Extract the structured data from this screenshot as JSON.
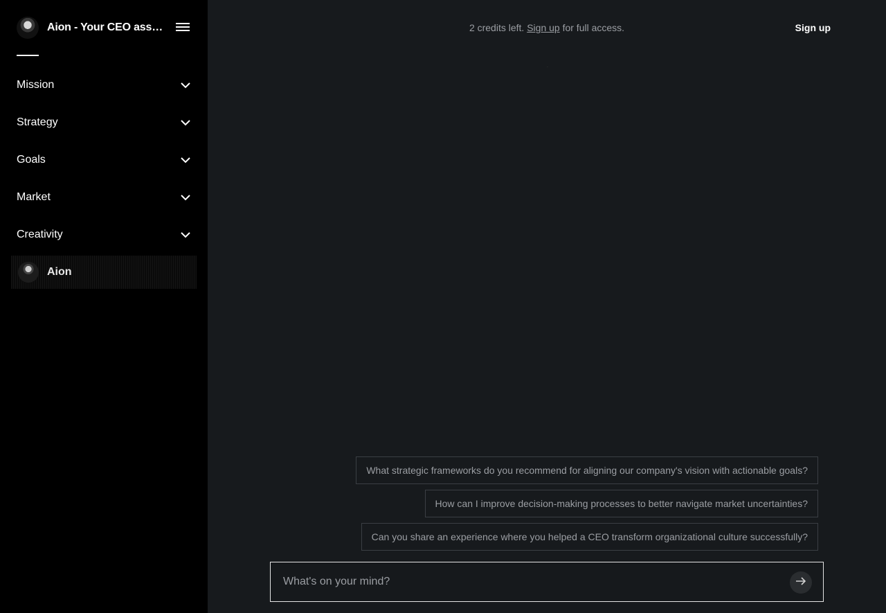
{
  "sidebar": {
    "title": "Aion - Your CEO assistant",
    "menu_icon": "hamburger-menu-icon",
    "items": [
      {
        "label": "Mission",
        "icon": "chevron-down-icon"
      },
      {
        "label": "Strategy",
        "icon": "chevron-down-icon"
      },
      {
        "label": "Goals",
        "icon": "chevron-down-icon"
      },
      {
        "label": "Market",
        "icon": "chevron-down-icon"
      },
      {
        "label": "Creativity",
        "icon": "chevron-down-icon"
      }
    ],
    "assistant_label": "Aion"
  },
  "header": {
    "credits_prefix": "2 credits left.",
    "credits_link": "Sign up",
    "credits_suffix": "for full access.",
    "signup_button": "Sign up"
  },
  "suggestions": [
    "What strategic frameworks do you recommend for aligning our company's vision with actionable goals?",
    "How can I improve decision-making processes to better navigate market uncertainties?",
    "Can you share an experience where you helped a CEO transform organizational culture successfully?"
  ],
  "composer": {
    "placeholder": "What's on your mind?",
    "value": "",
    "send_icon": "arrow-right-icon"
  },
  "colors": {
    "sidebar_bg": "#000000",
    "main_bg": "#171a1d",
    "muted_text": "#9b9ea3",
    "border": "#3b3f44"
  }
}
